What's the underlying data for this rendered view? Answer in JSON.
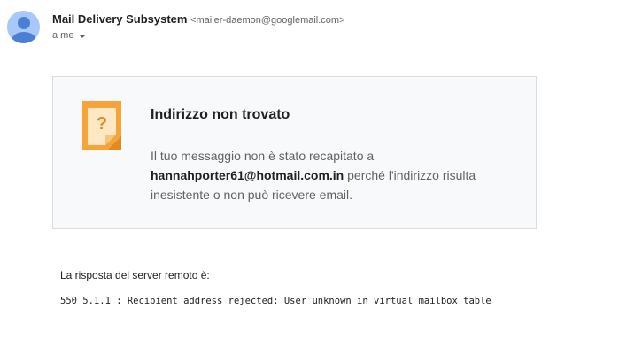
{
  "sender": {
    "name": "Mail Delivery Subsystem",
    "email": "<mailer-daemon@googlemail.com>",
    "to_label": "a me"
  },
  "notice": {
    "icon": "question-mark-note-icon",
    "title": "Indirizzo non trovato",
    "text_before": "Il tuo messaggio non è stato recapitato a ",
    "address": "hannahporter61@hotmail.com.in",
    "text_after": " perché l'indirizzo risulta inesistente o non può ricevere email."
  },
  "server": {
    "label": "La risposta del server remoto è:",
    "response": "550 5.1.1 : Recipient address rejected: User unknown in virtual mailbox table"
  },
  "colors": {
    "avatar_bg": "#a8c7fa",
    "avatar_fg": "#4a7fd4",
    "icon_orange": "#f6a43a",
    "card_bg": "#f8f9fa"
  }
}
